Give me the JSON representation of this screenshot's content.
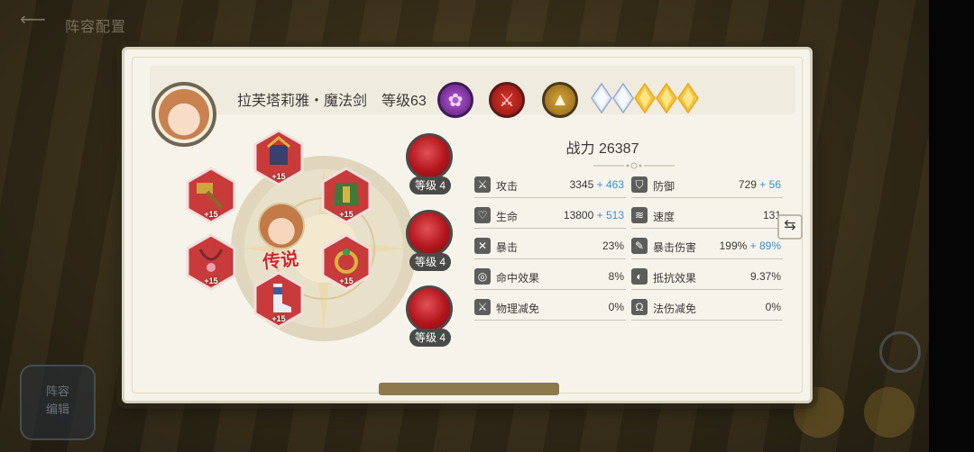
{
  "background": {
    "title": "阵容配置",
    "left_button": "阵容\n编辑"
  },
  "hero": {
    "name": "拉芙塔莉雅・魔法剑",
    "level": "等级63",
    "faction_icon": "purple-lotus-icon",
    "class_icon": "sword-class-icon",
    "role_icon": "team-role-icon",
    "stars": [
      "diamond",
      "diamond",
      "gold",
      "gold",
      "gold"
    ]
  },
  "equipment": [
    {
      "name": "crown-equip",
      "plus": "+15"
    },
    {
      "name": "hammer-equip",
      "plus": "+15"
    },
    {
      "name": "armor-equip",
      "plus": "+15"
    },
    {
      "name": "necklace-equip",
      "plus": "+15"
    },
    {
      "name": "ring-equip",
      "plus": "+15"
    },
    {
      "name": "boots-equip",
      "plus": "+15"
    }
  ],
  "legend_label": "传说",
  "skills": [
    {
      "level": "等级 4"
    },
    {
      "level": "等级 4"
    },
    {
      "level": "等级 4"
    }
  ],
  "power": {
    "label": "战力",
    "value": "26387"
  },
  "stats": [
    {
      "label": "攻击",
      "base": "3345",
      "bonus": "+ 463",
      "icon": "sword-icon"
    },
    {
      "label": "防御",
      "base": "729",
      "bonus": "+ 56",
      "icon": "shield-icon"
    },
    {
      "label": "生命",
      "base": "13800",
      "bonus": "+ 513",
      "icon": "heart-icon"
    },
    {
      "label": "速度",
      "base": "131",
      "bonus": "",
      "icon": "wind-icon"
    },
    {
      "label": "暴击",
      "base": "23%",
      "bonus": "",
      "icon": "crit-icon"
    },
    {
      "label": "暴击伤害",
      "base": "199%",
      "bonus": "+ 89%",
      "icon": "crit-damage-icon"
    },
    {
      "label": "命中效果",
      "base": "8%",
      "bonus": "",
      "icon": "target-icon"
    },
    {
      "label": "抵抗效果",
      "base": "9.37%",
      "bonus": "",
      "icon": "resist-icon"
    },
    {
      "label": "物理减免",
      "base": "0%",
      "bonus": "",
      "icon": "phys-reduce-icon"
    },
    {
      "label": "法伤减免",
      "base": "0%",
      "bonus": "",
      "icon": "magic-reduce-icon"
    }
  ],
  "colors": {
    "bonus": "#3c8fd2",
    "legend": "#d3262a",
    "equip_hex": "#c93a3b"
  }
}
